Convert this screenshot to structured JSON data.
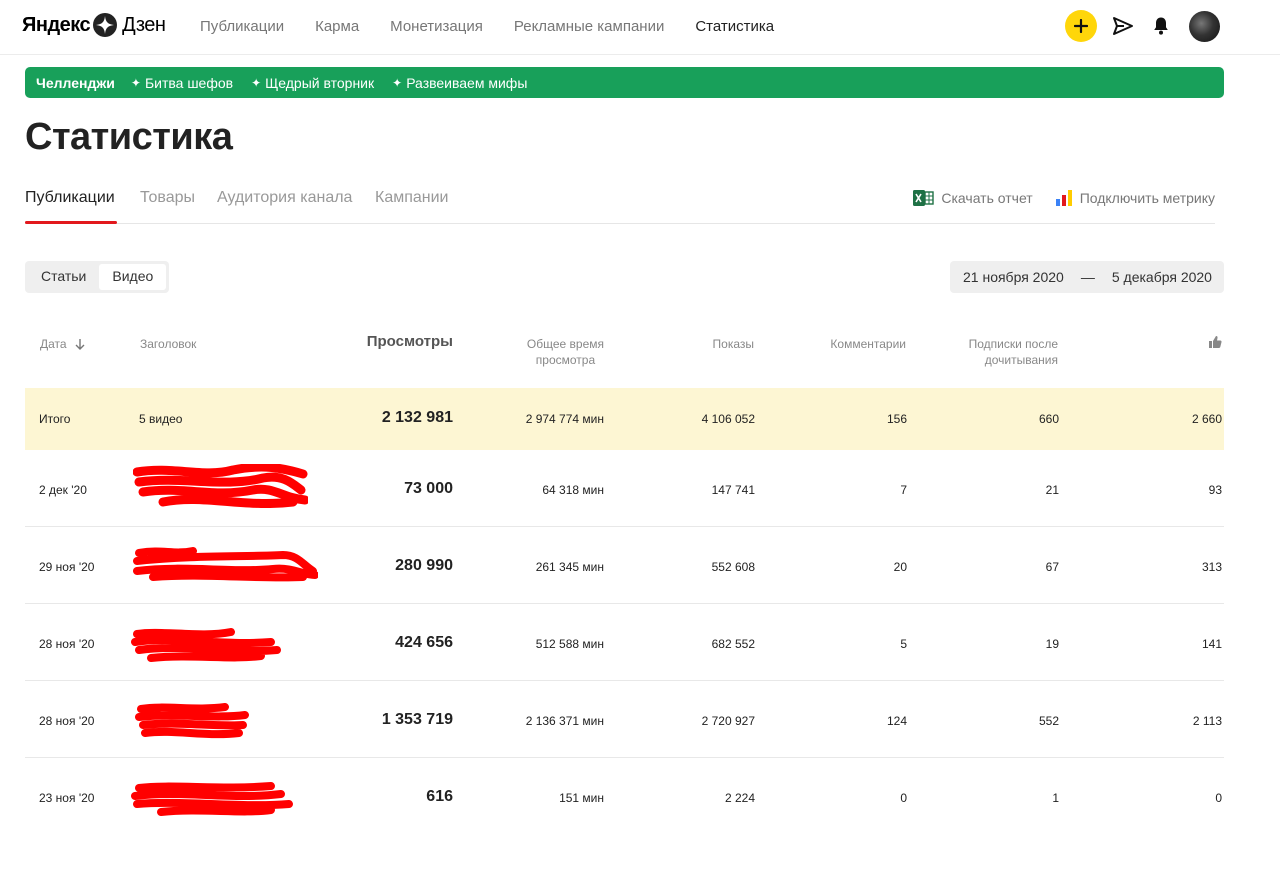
{
  "header": {
    "logo_brand": "Яндекс",
    "logo_product": "Дзен",
    "nav": [
      "Публикации",
      "Карма",
      "Монетизация",
      "Рекламные кампании",
      "Статистика"
    ],
    "active_nav": "Статистика"
  },
  "banner": {
    "title": "Челленджи",
    "items": [
      "Битва шефов",
      "Щедрый вторник",
      "Развеиваем мифы"
    ],
    "color": "#18a05a"
  },
  "page_title": "Статистика",
  "tabs": {
    "items": [
      "Публикации",
      "Товары",
      "Аудитория канала",
      "Кампании"
    ],
    "active": "Публикации",
    "download_label": "Скачать отчет",
    "metrika_label": "Подключить метрику"
  },
  "filter": {
    "segments": [
      "Статьи",
      "Видео"
    ],
    "active_segment": "Видео",
    "date_from": "21 ноября 2020",
    "date_sep": "—",
    "date_to": "5 декабря 2020"
  },
  "table": {
    "headers": {
      "date": "Дата",
      "title": "Заголовок",
      "views": "Просмотры",
      "watch_time_1": "Общее время",
      "watch_time_2": "просмотра",
      "impressions": "Показы",
      "comments": "Комментарии",
      "subs_1": "Подписки после",
      "subs_2": "дочитывания",
      "likes_icon": "thumbs-up-icon"
    },
    "total": {
      "date": "Итого",
      "title": "5 видео",
      "views": "2 132 981",
      "watch_time": "2 974 774 мин",
      "impressions": "4 106 052",
      "comments": "156",
      "subs": "660",
      "likes": "2 660"
    },
    "rows": [
      {
        "date": "2 дек '20",
        "views": "73 000",
        "watch_time": "64 318 мин",
        "impressions": "147 741",
        "comments": "7",
        "subs": "21",
        "likes": "93"
      },
      {
        "date": "29 ноя '20",
        "views": "280 990",
        "watch_time": "261 345 мин",
        "impressions": "552 608",
        "comments": "20",
        "subs": "67",
        "likes": "313"
      },
      {
        "date": "28 ноя '20",
        "views": "424 656",
        "watch_time": "512 588 мин",
        "impressions": "682 552",
        "comments": "5",
        "subs": "19",
        "likes": "141"
      },
      {
        "date": "28 ноя '20",
        "views": "1 353 719",
        "watch_time": "2 136 371 мин",
        "impressions": "2 720 927",
        "comments": "124",
        "subs": "552",
        "likes": "2 113"
      },
      {
        "date": "23 ноя '20",
        "views": "616",
        "watch_time": "151 мин",
        "impressions": "2 224",
        "comments": "0",
        "subs": "1",
        "likes": "0"
      }
    ]
  },
  "colors": {
    "accent_red": "#e2181d",
    "highlight_row": "#fdf6d3",
    "plus_yellow": "#ffd60a",
    "redaction": "#ff0000"
  }
}
